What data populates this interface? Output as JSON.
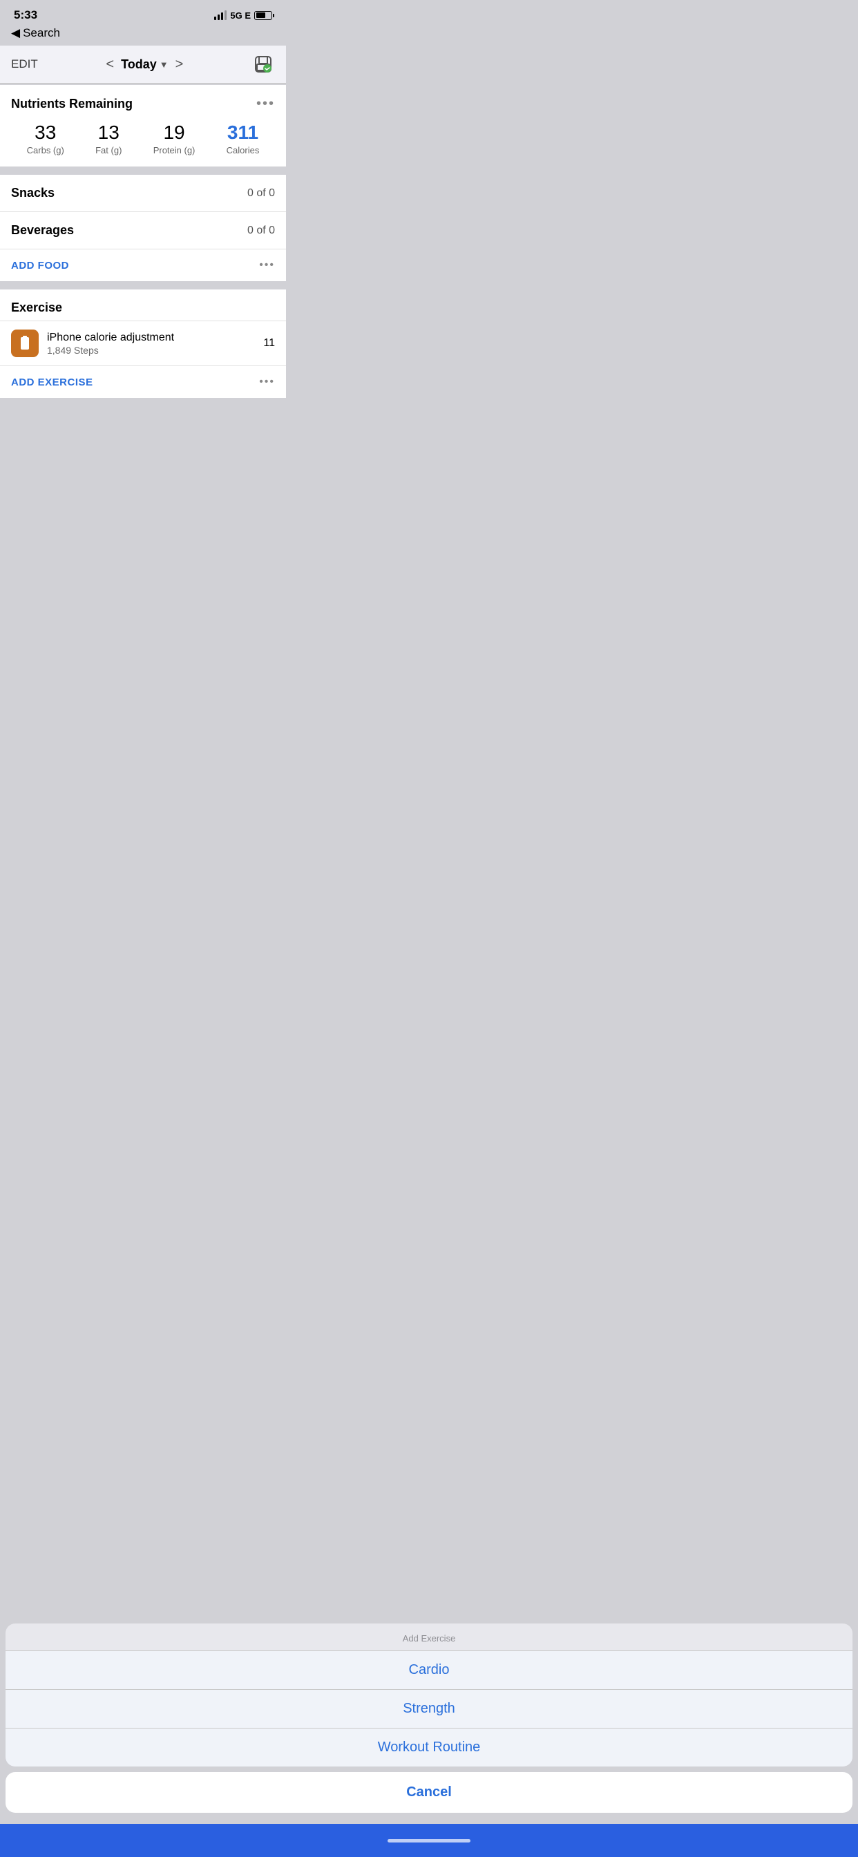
{
  "statusBar": {
    "time": "5:33",
    "network": "5G E"
  },
  "nav": {
    "backLabel": "Search",
    "editLabel": "EDIT",
    "todayLabel": "Today",
    "prevLabel": "<",
    "nextLabel": ">"
  },
  "nutrients": {
    "title": "Nutrients Remaining",
    "carbs": "33",
    "carbsLabel": "Carbs (g)",
    "fat": "13",
    "fatLabel": "Fat (g)",
    "protein": "19",
    "proteinLabel": "Protein (g)",
    "calories": "311",
    "caloriesLabel": "Calories"
  },
  "snacks": {
    "label": "Snacks",
    "value": "0 of 0"
  },
  "beverages": {
    "label": "Beverages",
    "value": "0 of 0"
  },
  "addFood": {
    "label": "ADD FOOD"
  },
  "exercise": {
    "title": "Exercise",
    "itemName": "iPhone calorie adjustment",
    "itemSteps": "1,849 Steps",
    "itemCals": "11"
  },
  "addExercise": {
    "label": "ADD EXERCISE"
  },
  "actionSheet": {
    "title": "Add Exercise",
    "cardioLabel": "Cardio",
    "strengthLabel": "Strength",
    "workoutRoutineLabel": "Workout Routine",
    "cancelLabel": "Cancel"
  }
}
